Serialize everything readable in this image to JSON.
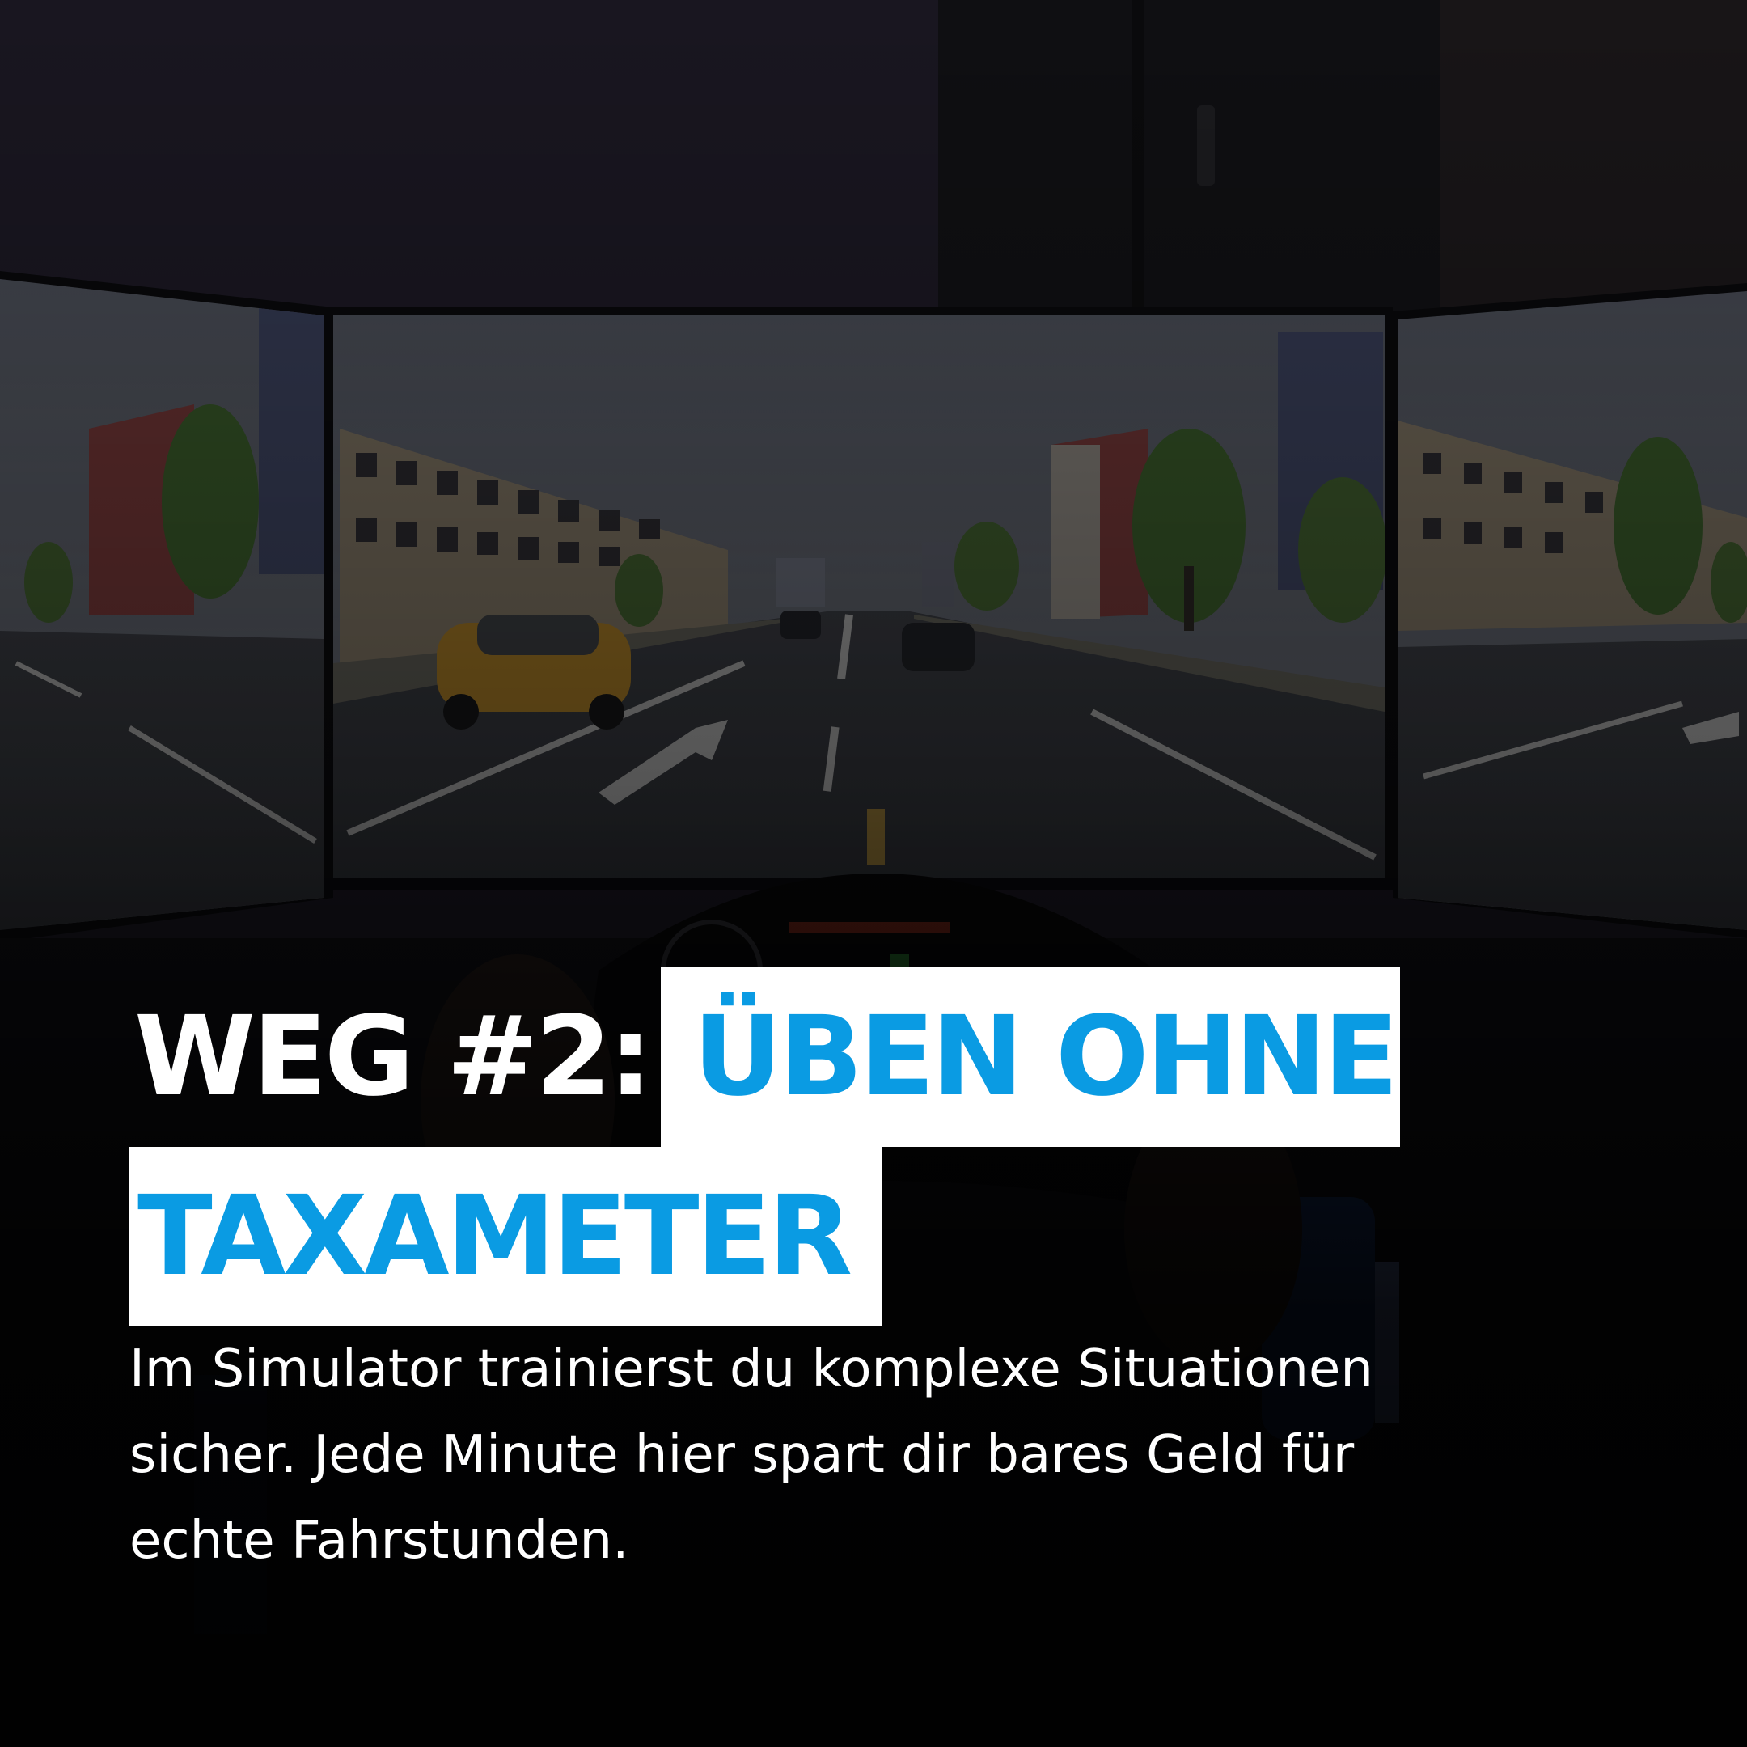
{
  "headline": {
    "prefix": "WEG #2:",
    "highlight_line1": "ÜBEN OHNE",
    "highlight_line2": "TAXAMETER"
  },
  "body": {
    "line1": "Im Simulator trainierst du komplexe Situationen",
    "line2": "sicher. Jede Minute hier spart dir bares Geld für",
    "line3": "echte Fahrstunden."
  },
  "colors": {
    "accent": "#0a9be3",
    "highlight_bg": "#ffffff",
    "overlay_dark": "#0b0b12"
  }
}
